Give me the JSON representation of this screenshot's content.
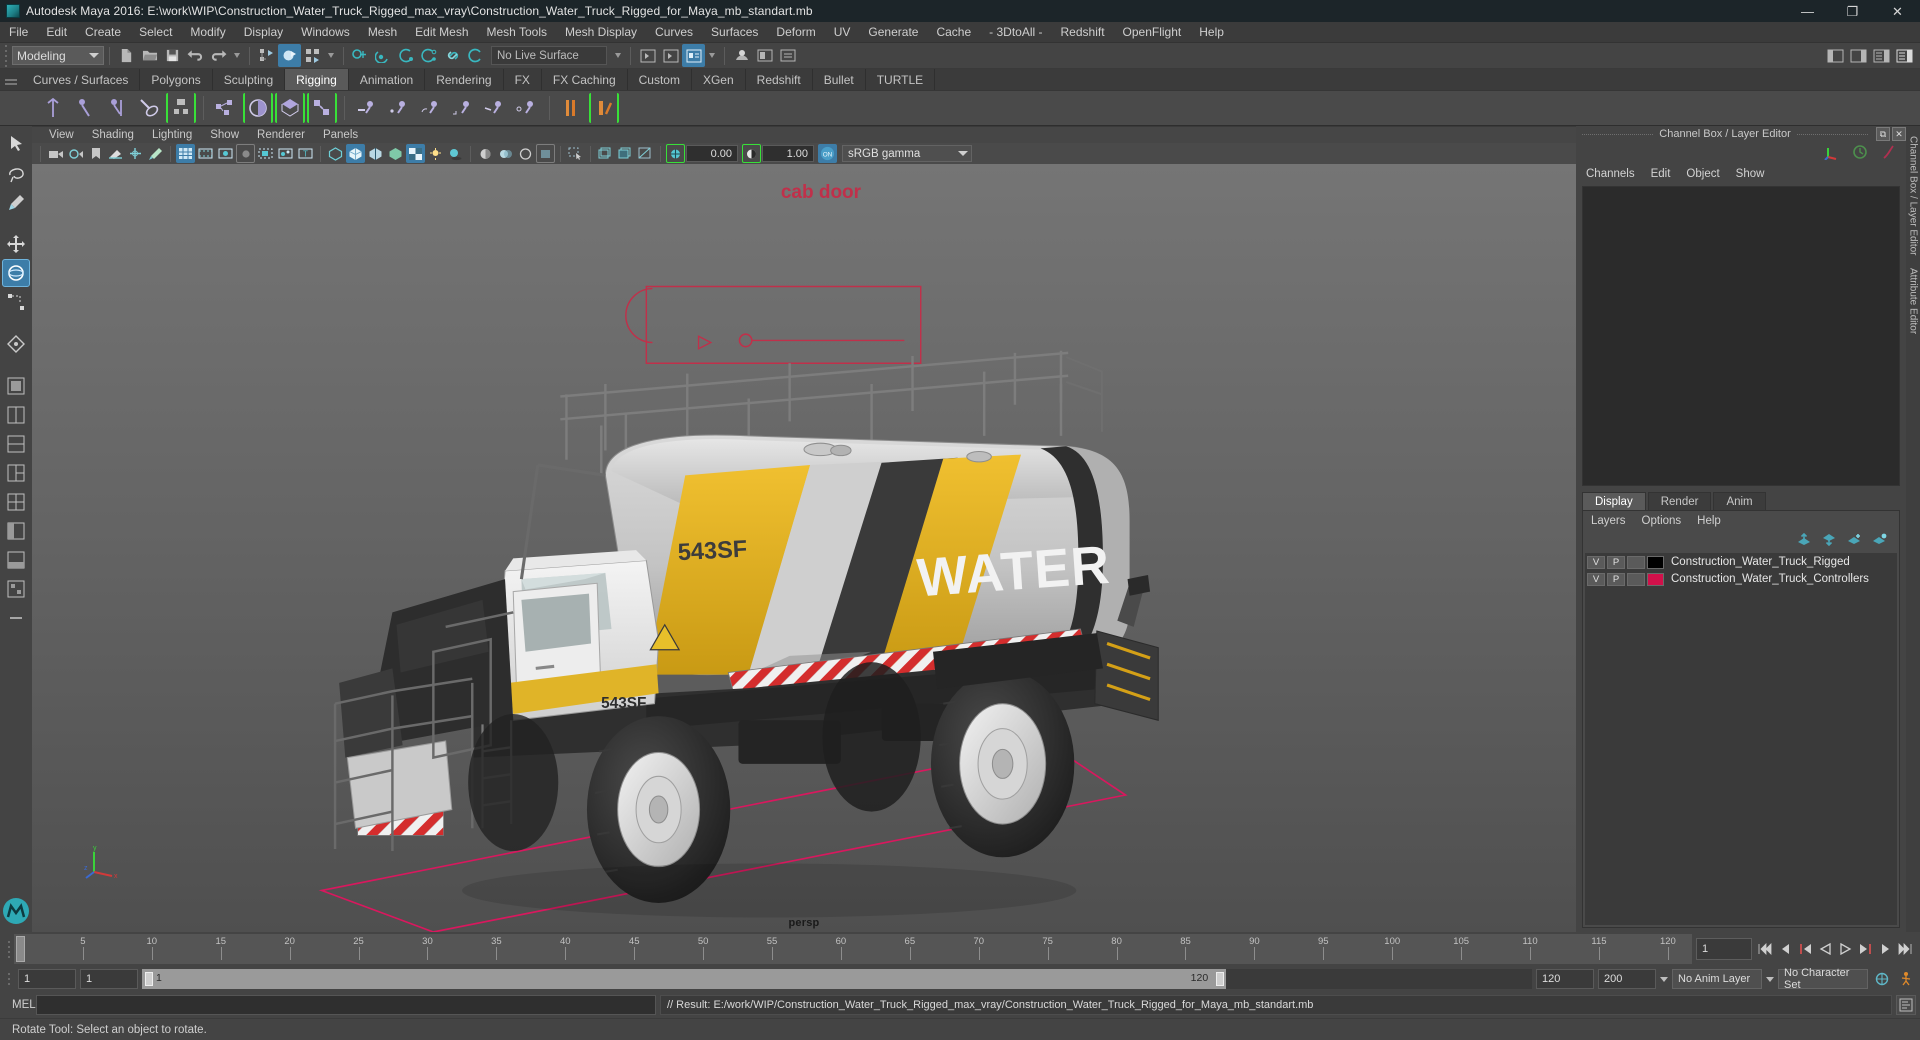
{
  "titlebar": {
    "text": "Autodesk Maya 2016: E:\\work\\WIP\\Construction_Water_Truck_Rigged_max_vray\\Construction_Water_Truck_Rigged_for_Maya_mb_standart.mb",
    "minimize": "—",
    "maximize": "❐",
    "close": "✕"
  },
  "menubar": {
    "items": [
      "File",
      "Edit",
      "Create",
      "Select",
      "Modify",
      "Display",
      "Windows",
      "Mesh",
      "Edit Mesh",
      "Mesh Tools",
      "Mesh Display",
      "Curves",
      "Surfaces",
      "Deform",
      "UV",
      "Generate",
      "Cache",
      "- 3DtoAll -",
      "Redshift",
      "OpenFlight",
      "Help"
    ]
  },
  "statusline": {
    "mode": "Modeling",
    "live_surface": "No Live Surface"
  },
  "shelf": {
    "tabs": [
      "Curves / Surfaces",
      "Polygons",
      "Sculpting",
      "Rigging",
      "Animation",
      "Rendering",
      "FX",
      "FX Caching",
      "Custom",
      "XGen",
      "Redshift",
      "Bullet",
      "TURTLE"
    ],
    "active_tab": "Rigging"
  },
  "viewport": {
    "menus": [
      "View",
      "Shading",
      "Lighting",
      "Show",
      "Renderer",
      "Panels"
    ],
    "exposure": "0.00",
    "gamma": "1.00",
    "color_profile": "sRGB gamma",
    "camera_label": "persp",
    "annotation": "cab door",
    "truck_text_number": "543SF",
    "truck_text_word": "WATER"
  },
  "channelbox": {
    "dock_title": "Channel Box / Layer Editor",
    "tabs": [
      "Channels",
      "Edit",
      "Object",
      "Show"
    ],
    "vertical_tabs": [
      "Channel Box / Layer Editor",
      "Attribute Editor"
    ]
  },
  "layereditor": {
    "tabs": [
      "Display",
      "Render",
      "Anim"
    ],
    "active_tab": "Display",
    "menus": [
      "Layers",
      "Options",
      "Help"
    ],
    "col_v": "V",
    "col_p": "P",
    "layers": [
      {
        "v": "V",
        "p": "P",
        "color": "#000000",
        "name": "Construction_Water_Truck_Rigged"
      },
      {
        "v": "V",
        "p": "P",
        "color": "#d1104a",
        "name": "Construction_Water_Truck_Controllers"
      }
    ]
  },
  "timeslider": {
    "ticks": [
      "5",
      "10",
      "15",
      "20",
      "25",
      "30",
      "35",
      "40",
      "45",
      "50",
      "55",
      "60",
      "65",
      "70",
      "75",
      "80",
      "85",
      "90",
      "95",
      "100",
      "105",
      "110",
      "115",
      "120"
    ],
    "current_frame": "1",
    "current_frame_field": "1"
  },
  "rangeslider": {
    "start": "1",
    "start2": "1",
    "range_left_label": "1",
    "range_right_label": "120",
    "end": "120",
    "playback_end": "200",
    "anim_layer": "No Anim Layer",
    "character_set": "No Character Set"
  },
  "commandline": {
    "mel_label": "MEL",
    "input_value": "",
    "output": "// Result: E:/work/WIP/Construction_Water_Truck_Rigged_max_vray/Construction_Water_Truck_Rigged_for_Maya_mb_standart.mb"
  },
  "helpline": {
    "text": "Rotate Tool: Select an object to rotate."
  },
  "colors": {
    "accent_blue": "#3d7da8",
    "shelf_green": "#38e038",
    "layer_red": "#d1104a",
    "title_bg": "#1c2529"
  }
}
